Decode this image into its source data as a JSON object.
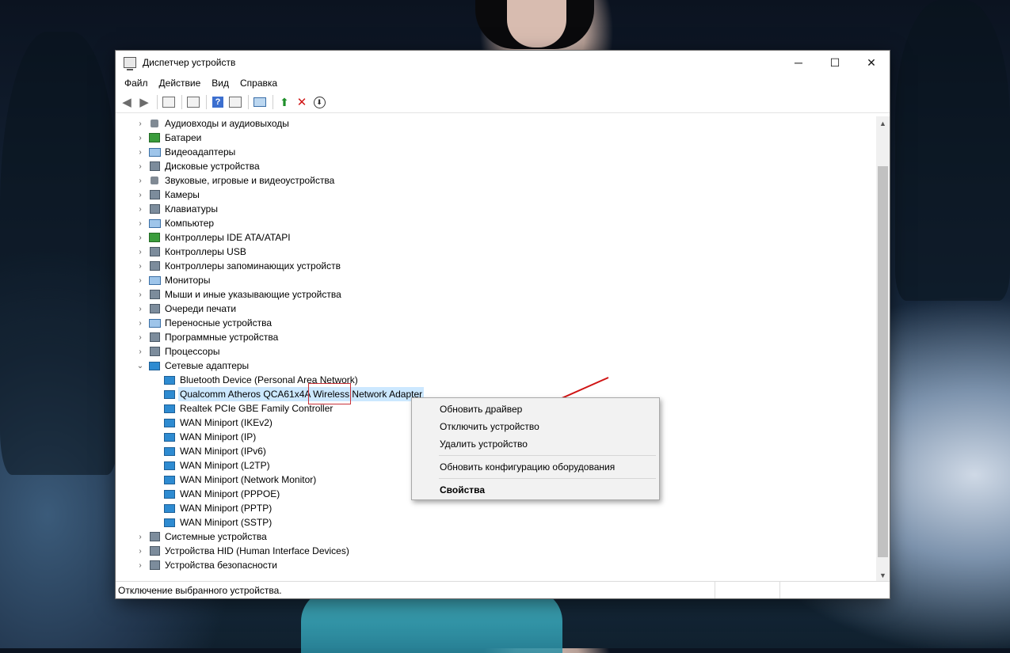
{
  "window": {
    "title": "Диспетчер устройств",
    "controls": {
      "minimize": "─",
      "maximize": "☐",
      "close": "✕"
    }
  },
  "menu": [
    "Файл",
    "Действие",
    "Вид",
    "Справка"
  ],
  "toolbar_icons": [
    "back-arrow-icon",
    "forward-arrow-icon",
    "properties-icon",
    "driver-icon",
    "help-icon",
    "view-icon",
    "monitor-icon",
    "update-driver-icon",
    "delete-icon",
    "download-icon"
  ],
  "tree": {
    "categories_before": [
      "Аудиовходы и аудиовыходы",
      "Батареи",
      "Видеоадаптеры",
      "Дисковые устройства",
      "Звуковые, игровые и видеоустройства",
      "Камеры",
      "Клавиатуры",
      "Компьютер",
      "Контроллеры IDE ATA/ATAPI",
      "Контроллеры USB",
      "Контроллеры запоминающих устройств",
      "Мониторы",
      "Мыши и иные указывающие устройства",
      "Очереди печати",
      "Переносные устройства",
      "Программные устройства",
      "Процессоры"
    ],
    "expanded_category": "Сетевые адаптеры",
    "network_adapters": [
      "Bluetooth Device (Personal Area Network)",
      "Qualcomm Atheros QCA61x4A Wireless Network Adapter",
      "Realtek PCIe GBE Family Controller",
      "WAN Miniport (IKEv2)",
      "WAN Miniport (IP)",
      "WAN Miniport (IPv6)",
      "WAN Miniport (L2TP)",
      "WAN Miniport (Network Monitor)",
      "WAN Miniport (PPPOE)",
      "WAN Miniport (PPTP)",
      "WAN Miniport (SSTP)"
    ],
    "categories_after": [
      "Системные устройства",
      "Устройства HID (Human Interface Devices)",
      "Устройства безопасности"
    ]
  },
  "context_menu": {
    "update_driver": "Обновить драйвер",
    "disable_device": "Отключить устройство",
    "uninstall_device": "Удалить устройство",
    "scan_hardware": "Обновить конфигурацию оборудования",
    "properties": "Свойства"
  },
  "status_text": "Отключение выбранного устройства.",
  "colors": {
    "selection": "#cce8ff",
    "annotation": "#c8323a"
  }
}
